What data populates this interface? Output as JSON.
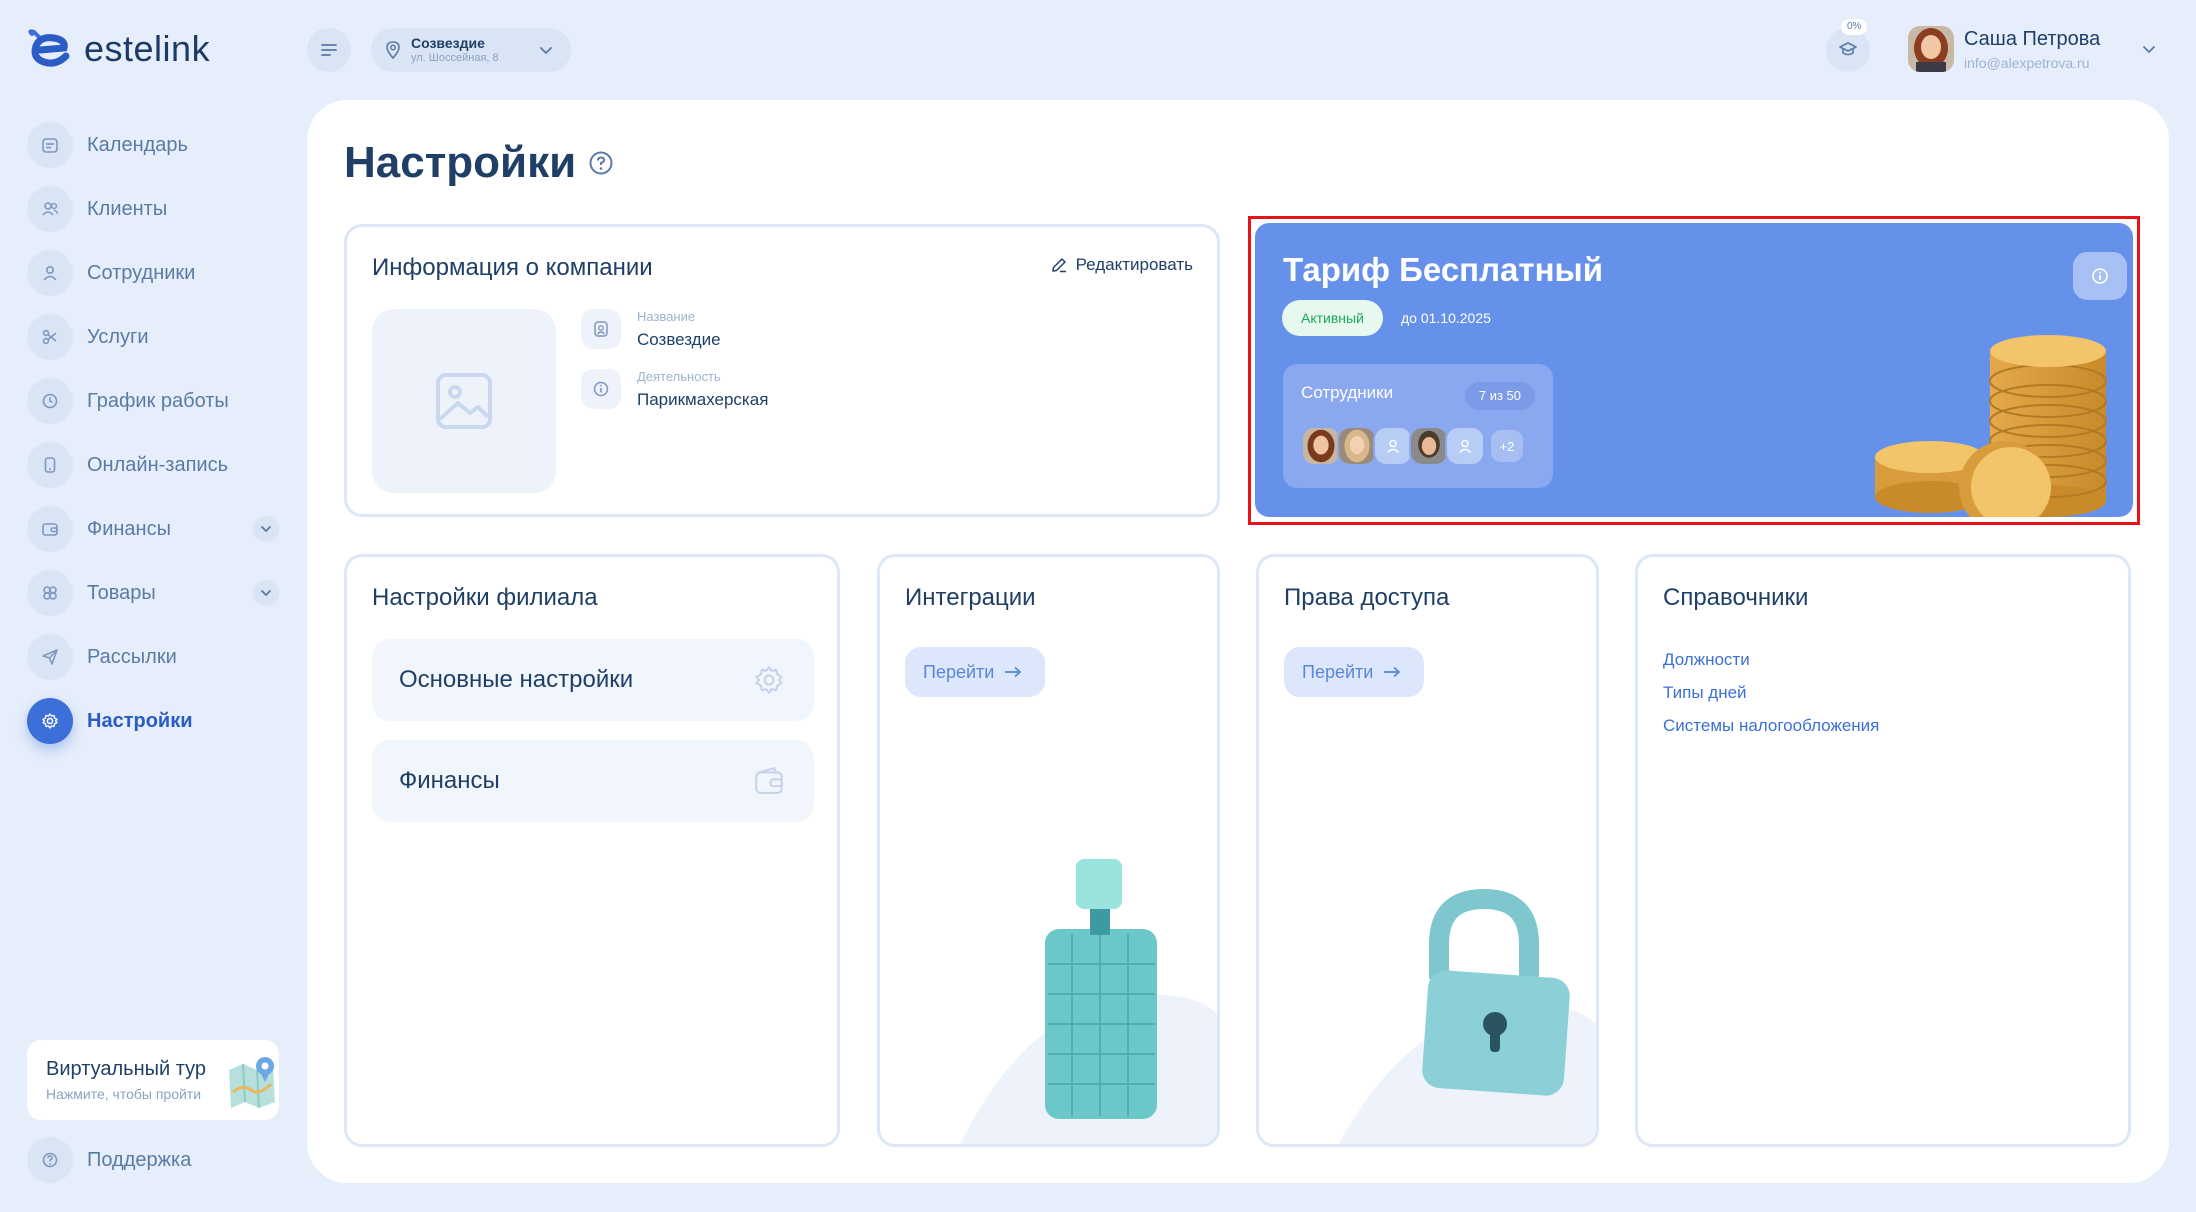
{
  "app": {
    "logo_text": "estelink"
  },
  "sidebar": {
    "items": [
      {
        "label": "Календарь"
      },
      {
        "label": "Клиенты"
      },
      {
        "label": "Сотрудники"
      },
      {
        "label": "Услуги"
      },
      {
        "label": "График работы"
      },
      {
        "label": "Онлайн-запись"
      },
      {
        "label": "Финансы"
      },
      {
        "label": "Товары"
      },
      {
        "label": "Рассылки"
      },
      {
        "label": "Настройки"
      }
    ],
    "active": "Настройки",
    "tour": {
      "title": "Виртуальный тур",
      "subtitle": "Нажмите, чтобы пройти"
    },
    "support_label": "Поддержка"
  },
  "topbar": {
    "branch": {
      "name": "Созвездие",
      "address": "ул. Шоссейная, 8"
    },
    "progress_badge": "0%",
    "user": {
      "name": "Саша Петрова",
      "email": "info@alexpetrova.ru"
    }
  },
  "page": {
    "title": "Настройки",
    "company": {
      "title": "Информация о компании",
      "edit_label": "Редактировать",
      "fields": [
        {
          "label": "Название",
          "value": "Созвездие"
        },
        {
          "label": "Деятельность",
          "value": "Парикмахерская"
        }
      ]
    },
    "tariff": {
      "title": "Тариф Бесплатный",
      "status": "Активный",
      "until": "до 01.10.2025",
      "staff_label": "Сотрудники",
      "staff_count": "7 из 50",
      "more": "+2"
    },
    "branch_settings": {
      "title": "Настройки филиала",
      "tiles": [
        {
          "label": "Основные настройки",
          "icon": "gear-icon"
        },
        {
          "label": "Финансы",
          "icon": "wallet-icon"
        }
      ]
    },
    "integrations": {
      "title": "Интеграции",
      "button": "Перейти"
    },
    "access": {
      "title": "Права доступа",
      "button": "Перейти"
    },
    "directories": {
      "title": "Справочники",
      "links": [
        "Должности",
        "Типы дней",
        "Системы налогообложения"
      ]
    }
  },
  "colors": {
    "accent": "#3d6fd8",
    "tariff_bg": "#6691ea",
    "active_badge": "#1fa85c",
    "highlight_frame": "#e6141a"
  }
}
